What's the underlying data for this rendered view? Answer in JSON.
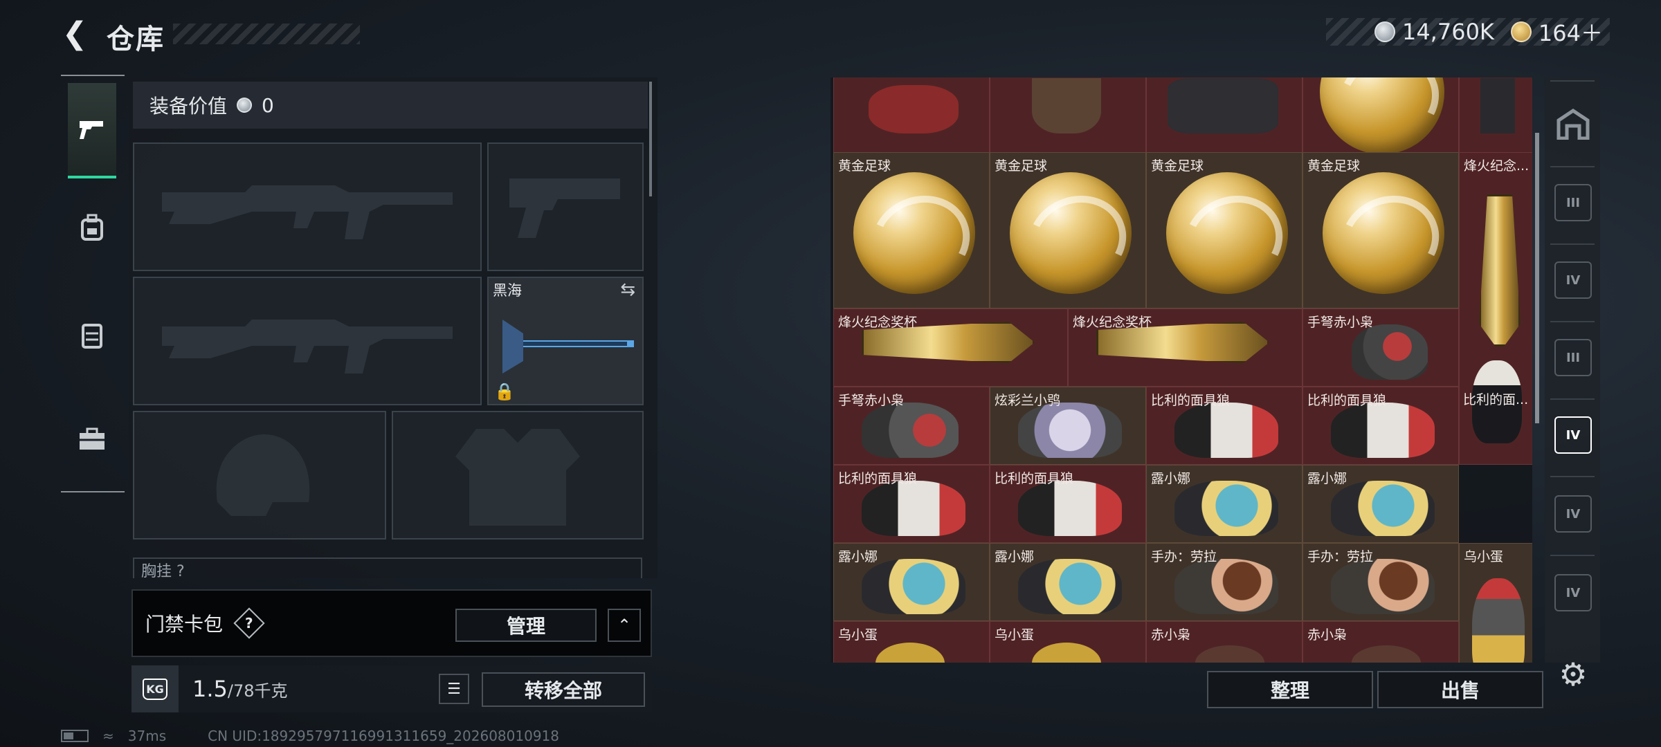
{
  "header": {
    "title": "仓库",
    "back_icon": "back-arrow-icon"
  },
  "currency": {
    "silver": "14,760K",
    "gold": "164＋",
    "silver_icon": "silver-coin-icon",
    "gold_icon": "gold-coin-icon"
  },
  "equipment": {
    "value_label": "装备价值",
    "value": "0",
    "melee_name": "黑海",
    "chest_label": "胸挂",
    "chest_suffix": "?"
  },
  "access_card": {
    "label": "门禁卡包",
    "help": "?",
    "manage": "管理"
  },
  "weight": {
    "icon": "KG",
    "current": "1.5",
    "max": "/78千克"
  },
  "actions": {
    "transfer_all": "转移全部",
    "sort": "整理",
    "sell": "出售"
  },
  "status": {
    "ping": "37ms",
    "uid": "CN UID:1892957971169913116​59_202608010918"
  },
  "stash": {
    "items": [
      {
        "label": "黄金足球"
      },
      {
        "label": "黄金足球"
      },
      {
        "label": "黄金足球"
      },
      {
        "label": "黄金足球"
      },
      {
        "label": "烽火纪念..."
      },
      {
        "label": "烽火纪念奖杯"
      },
      {
        "label": "烽火纪念奖杯"
      },
      {
        "label": "手弩赤小枭"
      },
      {
        "label": "手弩赤小枭"
      },
      {
        "label": "炫彩兰小鸮"
      },
      {
        "label": "比利的面具狼"
      },
      {
        "label": "比利的面具狼"
      },
      {
        "label": "比利的面..."
      },
      {
        "label": "比利的面具狼"
      },
      {
        "label": "比利的面具狼"
      },
      {
        "label": "露小娜"
      },
      {
        "label": "露小娜"
      },
      {
        "label": "露小娜"
      },
      {
        "label": "露小娜"
      },
      {
        "label": "手办：劳拉"
      },
      {
        "label": "手办：劳拉"
      },
      {
        "label": "乌小蛋"
      },
      {
        "label": "乌小蛋"
      },
      {
        "label": "乌小蛋"
      },
      {
        "label": "赤小枭"
      },
      {
        "label": "赤小枭"
      }
    ]
  },
  "right_rail": [
    "III",
    "IV",
    "III",
    "IV",
    "IV",
    "IV"
  ]
}
